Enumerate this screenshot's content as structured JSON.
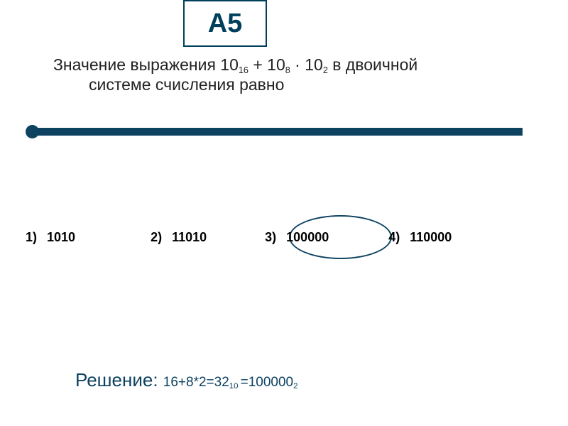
{
  "badge": "А5",
  "question": {
    "prefix": "Значение выражения ",
    "n1": "10",
    "sub1": "16",
    "plus": " + ",
    "n2": "10",
    "sub2": "8",
    "dot": " · ",
    "n3": "10",
    "sub3": "2",
    "suffix": " в двоичной",
    "line2": "системе счисления равно"
  },
  "options": {
    "o1": {
      "num": "1)",
      "val": "1010"
    },
    "o2": {
      "num": "2)",
      "val": "11010"
    },
    "o3": {
      "num": "3)",
      "val": "100000"
    },
    "o4": {
      "num": "4)",
      "val": "110000"
    }
  },
  "solution": {
    "label": "Решение: ",
    "p1": "16+8*2=32",
    "s1": "10 ",
    "p2": "=100000",
    "s2": "2"
  },
  "correct_answer_index": 3,
  "chart_data": null
}
